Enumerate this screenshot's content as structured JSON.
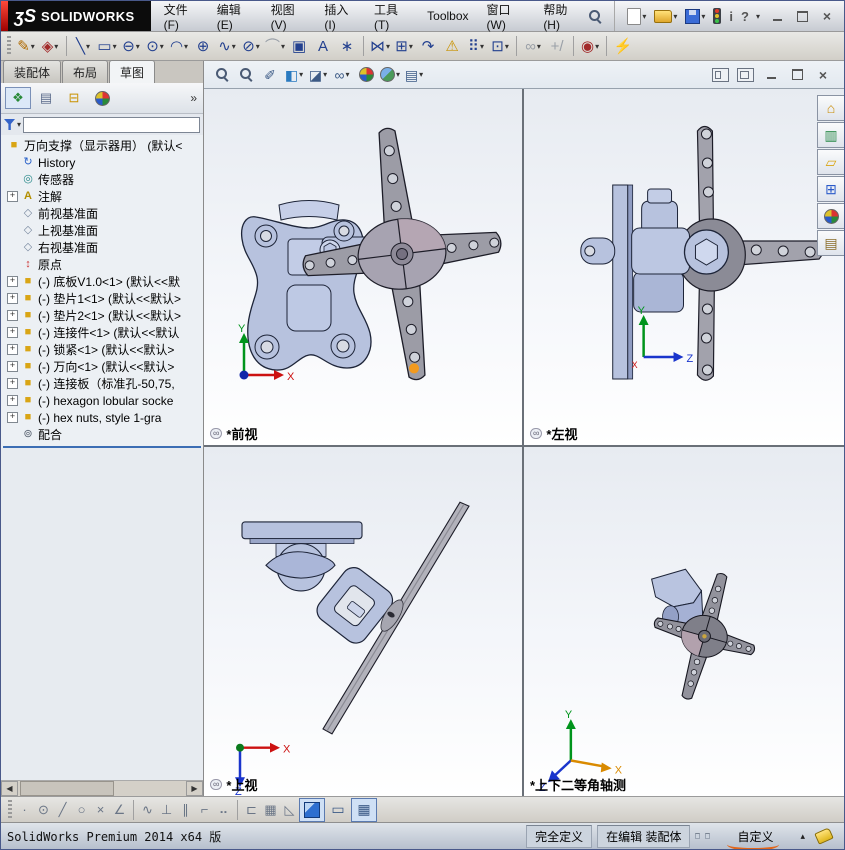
{
  "ui": {
    "caret": "▾",
    "chevron": "»",
    "plus": "+",
    "link": "∞",
    "min_glyph": "—",
    "close_glyph": "×",
    "info_glyph": "i",
    "help_glyph": "?"
  },
  "titlebar": {
    "brand_glyph": "ʒS",
    "brand": "SOLIDWORKS",
    "menus": [
      "文件(F)",
      "编辑(E)",
      "视图(V)",
      "插入(I)",
      "工具(T)",
      "Toolbox",
      "窗口(W)",
      "帮助(H)"
    ]
  },
  "sketch_toolbar": {
    "items": [
      {
        "name": "sketch",
        "glyph": "✎"
      },
      {
        "name": "smart-dimension",
        "glyph": "◈"
      },
      {
        "name": "line",
        "glyph": "╲"
      },
      {
        "name": "corner-rectangle",
        "glyph": "▭"
      },
      {
        "name": "straight-slot",
        "glyph": "⊖"
      },
      {
        "name": "circle",
        "glyph": "⊙"
      },
      {
        "name": "centerpoint-arc",
        "glyph": "◠"
      },
      {
        "name": "perimeter-circle",
        "glyph": "⊕"
      },
      {
        "name": "spline",
        "glyph": "∿"
      },
      {
        "name": "ellipse",
        "glyph": "⊘"
      },
      {
        "name": "sketch-fillet",
        "glyph": "⌒"
      },
      {
        "name": "convert-entities",
        "glyph": "▣"
      },
      {
        "name": "text",
        "glyph": "A"
      },
      {
        "name": "point",
        "glyph": "∗"
      },
      {
        "name": "mirror-entities",
        "glyph": "⋈"
      },
      {
        "name": "linear-sketch-pattern",
        "glyph": "⊞"
      },
      {
        "name": "move-entities",
        "glyph": "↷"
      },
      {
        "name": "repair-sketch",
        "glyph": "⚠"
      },
      {
        "name": "circular-sketch-pattern",
        "glyph": "⠿"
      },
      {
        "name": "pattern-options",
        "glyph": "⊡"
      },
      {
        "name": "display-relations",
        "glyph": "∞"
      },
      {
        "name": "add-relation",
        "glyph": "+/"
      },
      {
        "name": "quick-snaps",
        "glyph": "◉"
      },
      {
        "name": "sketch-snaps",
        "glyph": "⚡"
      }
    ]
  },
  "headsup": {
    "items": [
      {
        "name": "zoom-to-fit"
      },
      {
        "name": "zoom-to-area"
      },
      {
        "name": "previous-view",
        "glyph": "✐"
      },
      {
        "name": "section-view",
        "glyph": "◧"
      },
      {
        "name": "display-style",
        "glyph": "◪"
      },
      {
        "name": "hide-show-items",
        "glyph": "∞"
      },
      {
        "name": "edit-appearance"
      },
      {
        "name": "apply-scene"
      },
      {
        "name": "view-settings",
        "glyph": "▤"
      }
    ]
  },
  "left_panel": {
    "tabs": [
      "装配体",
      "布局",
      "草图"
    ],
    "active_tab": "草图",
    "tree": {
      "items": [
        {
          "glyph": "■",
          "label": "万向支撑（显示器用） (默认<"
        },
        {
          "glyph": "↻",
          "label": "History"
        },
        {
          "glyph": "◎",
          "label": "传感器"
        },
        {
          "glyph": "A",
          "label": "注解"
        },
        {
          "glyph": "◇",
          "label": "前视基准面"
        },
        {
          "glyph": "◇",
          "label": "上视基准面"
        },
        {
          "glyph": "◇",
          "label": "右视基准面"
        },
        {
          "glyph": "↕",
          "label": "原点"
        },
        {
          "glyph": "■",
          "label": "(-) 底板V1.0<1> (默认<<默"
        },
        {
          "glyph": "■",
          "label": "(-) 垫片1<1> (默认<<默认>"
        },
        {
          "glyph": "■",
          "label": "(-) 垫片2<1> (默认<<默认>"
        },
        {
          "glyph": "■",
          "label": "(-) 连接件<1> (默认<<默认"
        },
        {
          "glyph": "■",
          "label": "(-) 锁紧<1> (默认<<默认>"
        },
        {
          "glyph": "■",
          "label": "(-) 万向<1> (默认<<默认>"
        },
        {
          "glyph": "■",
          "label": "(-) 连接板（标准孔-50,75,"
        },
        {
          "glyph": "■",
          "label": "(-) hexagon lobular socke"
        },
        {
          "glyph": "■",
          "label": "(-) hex nuts, style 1-gra"
        },
        {
          "glyph": "⊚",
          "label": "配合"
        }
      ]
    }
  },
  "viewports": [
    {
      "label": "*前视",
      "axis_labels": {
        "a": "Y",
        "b": "X"
      }
    },
    {
      "label": "*左视",
      "axis_labels": {
        "a": "Y",
        "b": "Z",
        "c": "X"
      }
    },
    {
      "label": "*上视",
      "axis_labels": {
        "a": "X",
        "b": "Z"
      }
    },
    {
      "label": "*上下二等角轴测",
      "axis_labels": {
        "a": "Y",
        "b": "Z",
        "c": "X"
      }
    }
  ],
  "taskpane": {
    "items": [
      {
        "name": "solidworks-resources",
        "glyph": "⌂"
      },
      {
        "name": "design-library",
        "glyph": "▥"
      },
      {
        "name": "file-explorer",
        "glyph": "▱"
      },
      {
        "name": "view-palette",
        "glyph": "⊞"
      },
      {
        "name": "appearances-scenes",
        "glyph": ""
      },
      {
        "name": "custom-properties",
        "glyph": "▤"
      }
    ]
  },
  "snaps_toolbar": {
    "items": [
      {
        "name": "point-snap",
        "glyph": "·"
      },
      {
        "name": "center-snap",
        "glyph": "⊙"
      },
      {
        "name": "line-snap",
        "glyph": "╱"
      },
      {
        "name": "quadrant-snap",
        "glyph": "○"
      },
      {
        "name": "intersection-snap",
        "glyph": "×"
      },
      {
        "name": "angle-snap",
        "glyph": "∠"
      },
      {
        "name": "tangent-snap",
        "glyph": "∿"
      },
      {
        "name": "perpendicular-snap",
        "glyph": "⊥"
      },
      {
        "name": "parallel-snap",
        "glyph": "∥"
      },
      {
        "name": "hv-snap",
        "glyph": "⌐"
      },
      {
        "name": "near-snap",
        "glyph": "⠤"
      },
      {
        "name": "length-snap",
        "glyph": "⊏"
      },
      {
        "name": "grid-snap",
        "glyph": "▦"
      },
      {
        "name": "angle-display",
        "glyph": "◺"
      }
    ],
    "viewport_buttons": [
      {
        "name": "shaded-cube"
      },
      {
        "name": "single-viewport",
        "glyph": "▭"
      },
      {
        "name": "four-viewport",
        "glyph": "▦"
      }
    ]
  },
  "statusbar": {
    "product": "SolidWorks Premium 2014 x64 版",
    "define_state": "完全定义",
    "edit_state": "在编辑 装配体",
    "custom": "自定义",
    "custom_caret": "▴"
  }
}
